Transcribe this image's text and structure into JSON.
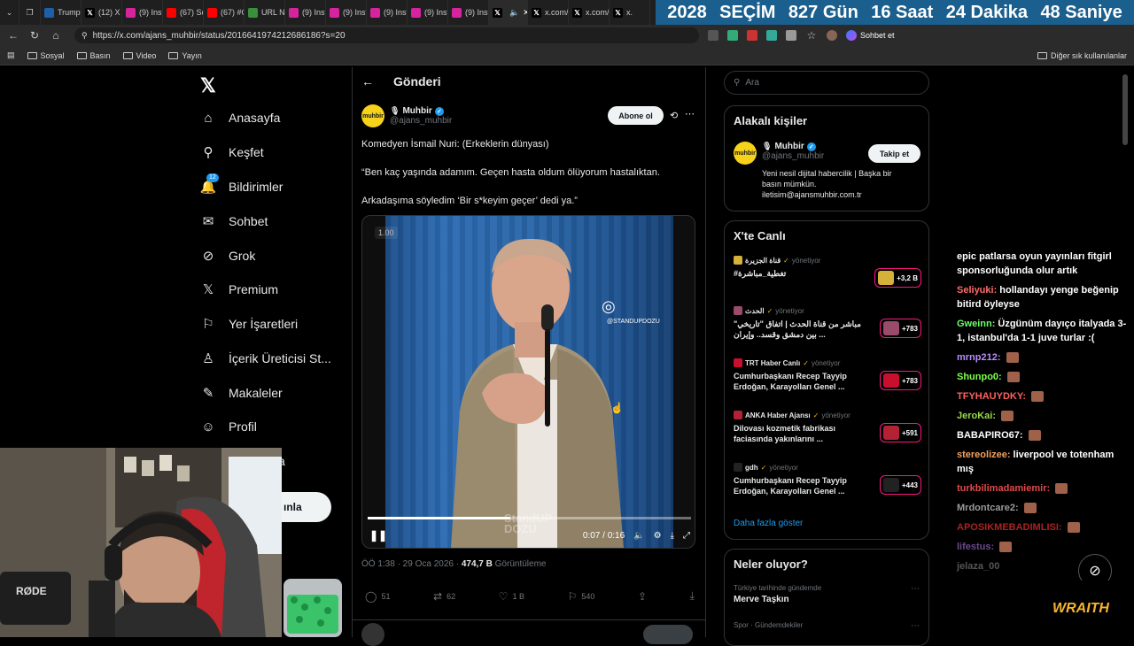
{
  "browser": {
    "tabs": [
      {
        "label": "Trump",
        "icon": "news-icon",
        "color": "#1d5fa8"
      },
      {
        "label": "(12) X",
        "icon": "x-icon",
        "color": "#000000"
      },
      {
        "label": "(9) Inst",
        "icon": "instagram-icon",
        "color": "#d6249f"
      },
      {
        "label": "(67) Sc",
        "icon": "youtube-icon",
        "color": "#ff0000"
      },
      {
        "label": "(67) #C",
        "icon": "youtube-icon",
        "color": "#ff0000"
      },
      {
        "label": "URL Ni",
        "icon": "link-icon",
        "color": "#3a8f3a"
      },
      {
        "label": "(9) Inst",
        "icon": "instagram-icon",
        "color": "#d6249f"
      },
      {
        "label": "(9) Inst",
        "icon": "instagram-icon",
        "color": "#d6249f"
      },
      {
        "label": "(9) Inst",
        "icon": "instagram-icon",
        "color": "#d6249f"
      },
      {
        "label": "(9) Inst",
        "icon": "instagram-icon",
        "color": "#d6249f"
      },
      {
        "label": "(9) Inst",
        "icon": "instagram-icon",
        "color": "#d6249f"
      },
      {
        "label": "",
        "icon": "x-icon",
        "color": "#000000"
      },
      {
        "label": "x.com/",
        "icon": "x-icon",
        "color": "#000000"
      },
      {
        "label": "x.com/",
        "icon": "x-icon",
        "color": "#000000"
      },
      {
        "label": "x.",
        "icon": "x-icon",
        "color": "#000000"
      }
    ],
    "url": "https://x.com/ajans_muhbir/status/2016641974212686186?s=20",
    "bookmarks": [
      "Sosyal",
      "Basın",
      "Video",
      "Yayın"
    ],
    "other_bookmarks": "Diğer sık kullanılanlar",
    "copilot": "Sohbet et"
  },
  "countdown": {
    "year": "2028",
    "label": "SEÇİM",
    "days": "827 Gün",
    "hours": "16 Saat",
    "minutes": "24 Dakika",
    "seconds": "48 Saniye"
  },
  "nav": {
    "items": [
      {
        "label": "Anasayfa",
        "icon": "home-icon"
      },
      {
        "label": "Keşfet",
        "icon": "search-icon"
      },
      {
        "label": "Bildirimler",
        "icon": "bell-icon",
        "badge": "12"
      },
      {
        "label": "Sohbet",
        "icon": "mail-icon"
      },
      {
        "label": "Grok",
        "icon": "grok-icon"
      },
      {
        "label": "Premium",
        "icon": "x-icon"
      },
      {
        "label": "Yer İşaretleri",
        "icon": "bookmark-icon"
      },
      {
        "label": "İçerik Üreticisi St...",
        "icon": "creator-icon"
      },
      {
        "label": "Makaleler",
        "icon": "article-icon"
      },
      {
        "label": "Profil",
        "icon": "person-icon"
      }
    ],
    "partial_more": "a",
    "post_button": "ınla"
  },
  "post": {
    "header_title": "Gönderi",
    "author_name": "Muhbir",
    "author_handle": "@ajans_muhbir",
    "avatar_text": "muhbir",
    "subscribe": "Abone ol",
    "line1": "Komedyen İsmail Nuri: (Erkeklerin dünyası)",
    "line2": "“Ben kaç yaşında adamım. Geçen hasta oldum ölüyorum hastalıktan.",
    "line3": "Arkadaşıma söyledim ‘Bir s*keyim geçer’ dedi ya.”",
    "video": {
      "speed": "1.00",
      "watermark_handle": "@STANDUPDOZU",
      "brand_line1": "StandUP",
      "brand_line2": "DOZU",
      "time": "0:07 / 0:16",
      "progress": 0.44
    },
    "timestamp": "ÖÖ 1:38 · 29 Oca 2026 · ",
    "views": "474,7 B",
    "views_label": " Görüntüleme",
    "stats": {
      "replies": "51",
      "reposts": "62",
      "likes": "1 B",
      "bookmarks": "540"
    }
  },
  "sidebar": {
    "search_placeholder": "Ara",
    "related_title": "Alakalı kişiler",
    "related": {
      "name": "Muhbir",
      "handle": "@ajans_muhbir",
      "follow": "Takip et",
      "bio1": "Yeni nesil dijital habercilik | Başka bir",
      "bio2": "basın mümkün.",
      "bio3": "iletisim@ajansmuhbir.com.tr"
    },
    "live_title": "X'te Canlı",
    "live": [
      {
        "source": "قناة الجزيرة",
        "role": "yönetiyor",
        "title": "#تغطية_مباشرة",
        "count": "+3,2 B",
        "thumb": "#d4b13a"
      },
      {
        "source": "الحدث",
        "role": "yönetiyor",
        "title": "مباشر من قناة الحدث | اتفاق \"تاريخي\" بين دمشق وقسد.. وإيران ...",
        "count": "+783",
        "thumb": "#9a4a6a"
      },
      {
        "source": "TRT Haber Canlı",
        "role": "yönetiyor",
        "title": "Cumhurbaşkanı Recep Tayyip Erdoğan, Karayolları Genel ...",
        "count": "+783",
        "thumb": "#c8102e"
      },
      {
        "source": "ANKA Haber Ajansı",
        "role": "yönetiyor",
        "title": "Dilovası kozmetik fabrikası faciasında yakınlarını ...",
        "count": "+591",
        "thumb": "#b22234"
      },
      {
        "source": "gdh",
        "role": "yönetiyor",
        "title": "Cumhurbaşkanı Recep Tayyip Erdoğan, Karayolları Genel ...",
        "count": "+443",
        "thumb": "#222222"
      }
    ],
    "show_more": "Daha fazla göster",
    "trends_title": "Neler oluyor?",
    "trends": [
      {
        "category": "Türkiye tarihinde gündemde",
        "name": "Merve Taşkın"
      },
      {
        "category": "Spor · Gündemdekiler",
        "name": ""
      }
    ]
  },
  "chat": {
    "messages": [
      {
        "user": "",
        "text": "epic patlarsa oyun yayınları fitgirl sponsorluğunda olur artık",
        "color": "#ffffff"
      },
      {
        "user": "Seliyuki:",
        "text": "hollandayı yenge beğenip bitird öyleyse",
        "color": "#ff6b6b"
      },
      {
        "user": "Gweinn:",
        "text": "Üzgünüm dayıço italyada 3-1, istanbul'da 1-1 juve turlar :(",
        "color": "#6bff6b"
      },
      {
        "user": "mrnp212:",
        "text": "",
        "color": "#b88cff"
      },
      {
        "user": "Shunpo0:",
        "text": "",
        "color": "#7cff4d"
      },
      {
        "user": "TFYHAUYDKY:",
        "text": "",
        "color": "#ff6060"
      },
      {
        "user": "JeroKai:",
        "text": "",
        "color": "#9ad94c"
      },
      {
        "user": "BABAPIRO67:",
        "text": "",
        "color": "#ffffff"
      },
      {
        "user": "stereolizee:",
        "text": "liverpool ve totenham mış",
        "color": "#f4a261"
      },
      {
        "user": "turkbilimadamiemir:",
        "text": "",
        "color": "#e04a4a"
      },
      {
        "user": "Mrdontcare2:",
        "text": "",
        "color": "#9a9a9a"
      },
      {
        "user": "APOSIKMEBADIMLISI:",
        "text": "",
        "color": "#aa2222"
      },
      {
        "user": "lifestus:",
        "text": "",
        "color": "#6a4a8a"
      },
      {
        "user": "",
        "text": "jelaza_00",
        "color": "#555555"
      }
    ],
    "brand": "WRAITH"
  },
  "colors": {
    "accent": "#1d9bf0",
    "live_ring": "#f91880",
    "countdown_bg": "#1a5f8e"
  }
}
